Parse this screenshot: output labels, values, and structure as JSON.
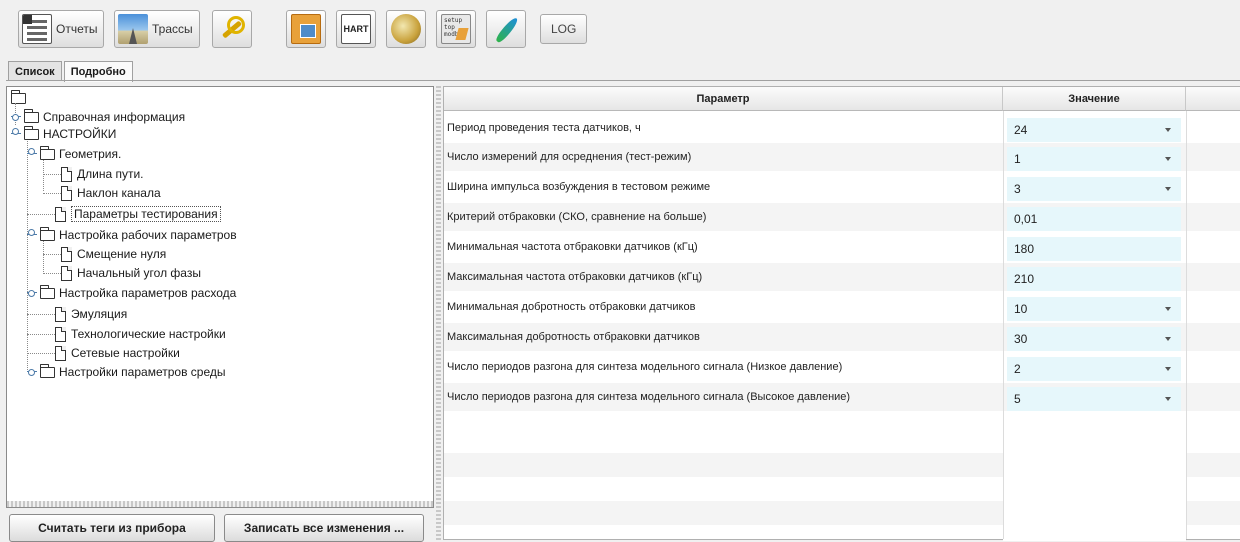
{
  "toolbar": {
    "reports_label": "Отчеты",
    "traces_label": "Трассы",
    "hart_label": "HART",
    "setup_label": "setup\ntop\nmodbus",
    "log_label": "LOG"
  },
  "tabs": [
    {
      "label": "Список",
      "active": false
    },
    {
      "label": "Подробно",
      "active": true
    }
  ],
  "tree": {
    "items": [
      {
        "label": "Справочная информация"
      },
      {
        "label": "НАСТРОЙКИ"
      },
      {
        "label": "Геометрия."
      },
      {
        "label": "Длина пути."
      },
      {
        "label": "Наклон канала"
      },
      {
        "label": "Параметры тестирования",
        "selected": true
      },
      {
        "label": "Настройка рабочих параметров"
      },
      {
        "label": "Смещение нуля"
      },
      {
        "label": "Начальный угол фазы"
      },
      {
        "label": "Настройка параметров расхода"
      },
      {
        "label": "Эмуляция"
      },
      {
        "label": "Технологические настройки"
      },
      {
        "label": "Сетевые настройки"
      },
      {
        "label": "Настройки параметров среды"
      }
    ]
  },
  "buttons": {
    "read_tags": "Считать теги из прибора",
    "write_all": "Записать все изменения ..."
  },
  "table": {
    "headers": {
      "param": "Параметр",
      "value": "Значение"
    },
    "rows": [
      {
        "param": "Период проведения теста датчиков, ч",
        "value": "24",
        "dropdown": true
      },
      {
        "param": "Число измерений для осреднения (тест-режим)",
        "value": "1",
        "dropdown": true
      },
      {
        "param": "Ширина импульса возбуждения в тестовом режиме",
        "value": "3",
        "dropdown": true
      },
      {
        "param": "Критерий отбраковки (СКО, сравнение на больше)",
        "value": "0,01",
        "dropdown": false
      },
      {
        "param": "Минимальная частота отбраковки датчиков (кГц)",
        "value": "180",
        "dropdown": false
      },
      {
        "param": "Максимальная частота отбраковки датчиков (кГц)",
        "value": "210",
        "dropdown": false
      },
      {
        "param": "Минимальная добротность отбраковки датчиков",
        "value": "10",
        "dropdown": true
      },
      {
        "param": "Максимальная добротность отбраковки датчиков",
        "value": "30",
        "dropdown": true
      },
      {
        "param": "Число периодов разгона для синтеза модельного сигнала (Низкое давление)",
        "value": "2",
        "dropdown": true
      },
      {
        "param": "Число периодов разгона для синтеза модельного сигнала (Высокое давление)",
        "value": "5",
        "dropdown": true
      }
    ]
  },
  "colors": {
    "value_cell_bg": "#e6f7fb",
    "accent": "#4d7aa8"
  }
}
